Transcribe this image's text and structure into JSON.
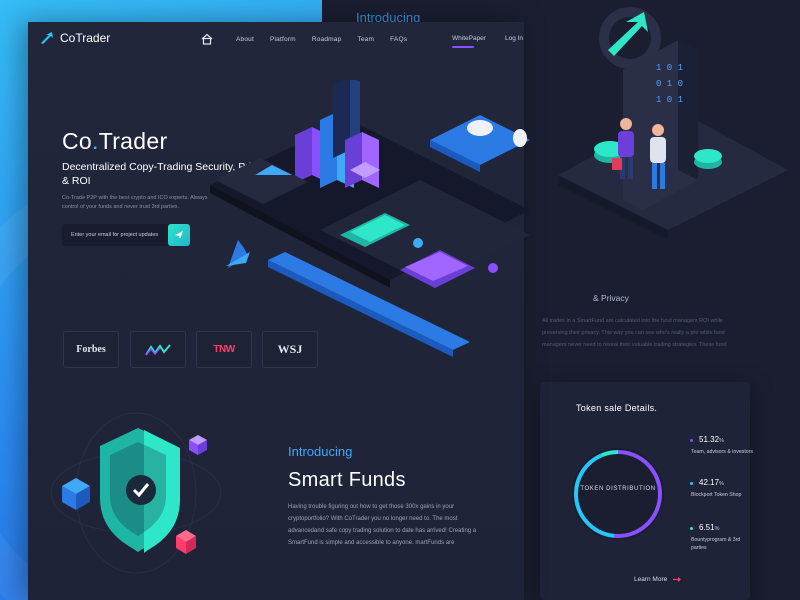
{
  "brand": {
    "name": "CoTrader",
    "accent": "#26c6f9",
    "purple": "#8a4fff"
  },
  "nav": {
    "home_icon": "home-icon",
    "links": [
      "About",
      "Platform",
      "Roadmap",
      "Team",
      "FAQs"
    ],
    "whitepaper": "WhitePaper",
    "login": "Log In"
  },
  "hero": {
    "title_a": "Co",
    "title_dot": ".",
    "title_b": "Trader",
    "subtitle": "Decentralized Copy-Trading Security, Privacy &  ROI",
    "description": "Co-Trade P2P with the best crypto and ICO experts. Always control of your funds and never trust 3rd parties.",
    "email_placeholder": "Enter your email for project updates"
  },
  "press": {
    "forbes": "Forbes",
    "tnw": "TNW",
    "wsj": "WSJ"
  },
  "smart_funds": {
    "intro": "Introducing",
    "title": "Smart Funds",
    "description": "Having trouble figuring out how to get those 300x gains in your cryptoportfolio? With CoTrader you no longer need to. The most advancedand safe copy trading solution to date has arrived! Creating a SmartFund is simple and accessible to anyone.  martFunds are"
  },
  "background_panel": {
    "intro": "Introducing",
    "privacy_title": "& Privacy",
    "privacy_text": "All trades in a SmartFund are calculated into the fund managers ROI while preserving their privacy. This way you can see who's really a pro while fund managers never need to reveal their valuable trading strategies. These fund"
  },
  "token_sale": {
    "title": "Token sale Details.",
    "center_label": "TOKEN DISTRIBUTION",
    "items": [
      {
        "value": "51.32",
        "unit": "%",
        "label": "Team, advisors & investors",
        "color": "#8a4fff"
      },
      {
        "value": "42.17",
        "unit": "%",
        "label": "Blockport Token Shop",
        "color": "#26c6f9"
      },
      {
        "value": "6.51",
        "unit": "%",
        "label": "Bountyprogram & 3rd parties",
        "color": "#2ee6c8"
      }
    ],
    "learn_more": "Learn More"
  }
}
